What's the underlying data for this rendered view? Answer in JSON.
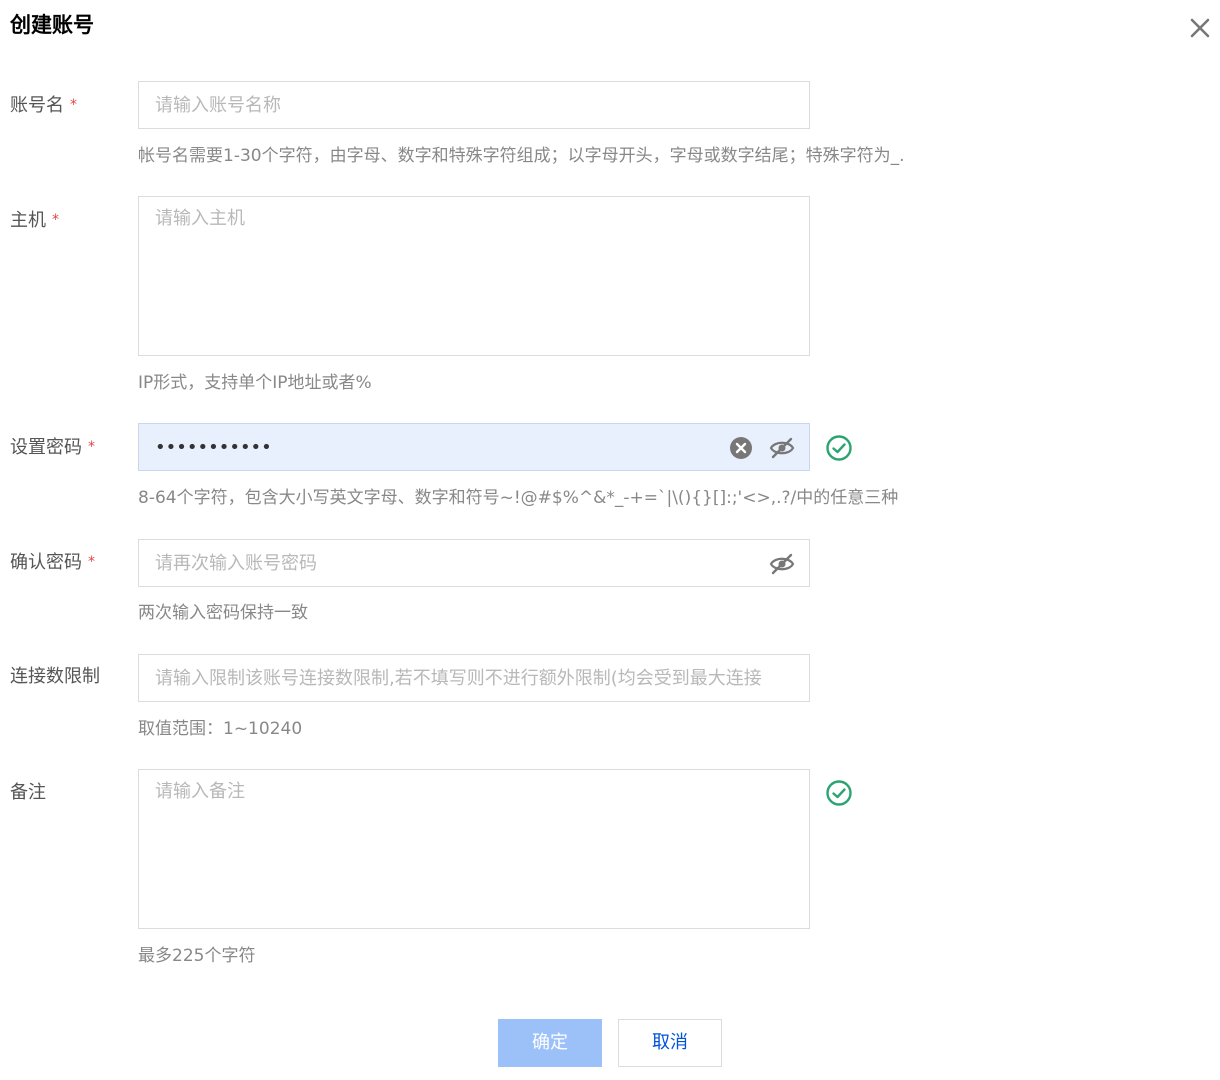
{
  "dialog": {
    "title": "创建账号"
  },
  "colors": {
    "accent": "#0052d9",
    "ok_disabled": "#9cc1f8",
    "required": "#e54545",
    "success": "#2ba471",
    "focused_bg": "#e8f0fe"
  },
  "form": {
    "account_name": {
      "label": "账号名",
      "required": "*",
      "placeholder": "请输入账号名称",
      "value": "",
      "hint": "帐号名需要1-30个字符，由字母、数字和特殊字符组成；以字母开头，字母或数字结尾；特殊字符为_."
    },
    "host": {
      "label": "主机",
      "required": "*",
      "placeholder": "请输入主机",
      "value": "",
      "hint": "IP形式，支持单个IP地址或者%"
    },
    "password": {
      "label": "设置密码",
      "required": "*",
      "value": "•••••••••••",
      "hint": "8-64个字符，包含大小写英文字母、数字和符号~!@#$%^&*_-+=`|\\(){}[]:;'<>,.?/中的任意三种",
      "icons": [
        "clear-icon",
        "eye-off-icon",
        "check-circle-icon"
      ]
    },
    "confirm_password": {
      "label": "确认密码",
      "required": "*",
      "placeholder": "请再次输入账号密码",
      "value": "",
      "hint": "两次输入密码保持一致",
      "icons": [
        "eye-off-icon"
      ]
    },
    "connection_limit": {
      "label": "连接数限制",
      "placeholder": "请输入限制该账号连接数限制,若不填写则不进行额外限制(均会受到最大连接",
      "value": "",
      "hint": "取值范围：1~10240"
    },
    "remark": {
      "label": "备注",
      "placeholder": "请输入备注",
      "value": "",
      "hint": "最多225个字符",
      "icons": [
        "check-circle-icon"
      ]
    }
  },
  "footer": {
    "ok_label": "确定",
    "cancel_label": "取消"
  }
}
